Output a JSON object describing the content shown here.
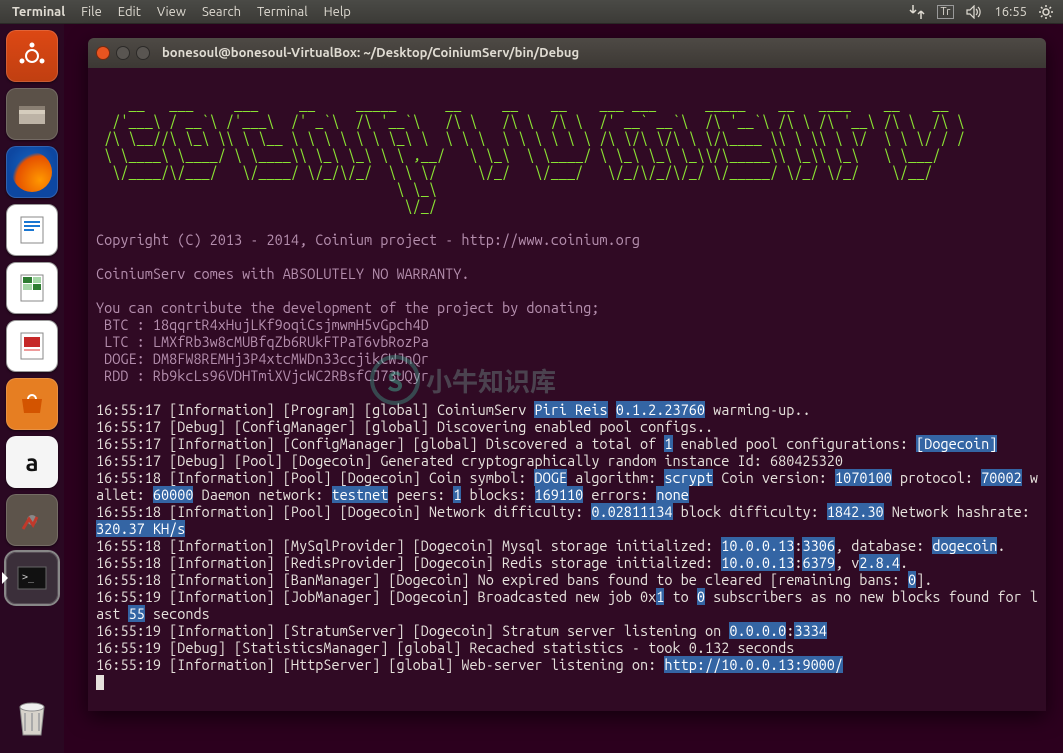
{
  "topbar": {
    "app_name": "Terminal",
    "menus": [
      "File",
      "Edit",
      "View",
      "Search",
      "Terminal",
      "Help"
    ],
    "keyboard_indicator": "Tr",
    "clock": "16:55"
  },
  "launcher": {
    "items": [
      {
        "name": "dash",
        "tip": "Dash"
      },
      {
        "name": "files",
        "tip": "Files"
      },
      {
        "name": "firefox",
        "tip": "Firefox"
      },
      {
        "name": "writer",
        "tip": "LibreOffice Writer"
      },
      {
        "name": "calc",
        "tip": "LibreOffice Calc"
      },
      {
        "name": "impress",
        "tip": "LibreOffice Impress"
      },
      {
        "name": "software",
        "tip": "Ubuntu Software"
      },
      {
        "name": "amazon",
        "tip": "Amazon"
      },
      {
        "name": "settings",
        "tip": "System Settings"
      },
      {
        "name": "terminal",
        "tip": "Terminal"
      }
    ],
    "trash": "Trash"
  },
  "window": {
    "title": "bonesoul@bonesoul-VirtualBox: ~/Desktop/CoiniumServ/bin/Debug"
  },
  "banner": {
    "ascii": "    __   ___     ___     __     _____      __     __    __    ___ ___      _____    __   ____    __    __\n  /'___\\ / __`\\ /'___\\  /' _`\\  /\\ '__`\\   /\\ \\   /\\ \\  /\\ \\  /' __` __`\\  /\\ '__`\\ /\\ \\ /\\ '__\\ /\\ \\  /\\ \\\n /\\ \\__//\\ \\_\\ \\\\ \\ \\__ \\ \\ \\ \\ \\ \\ \\_\\ \\  \\ \\ \\  \\ \\ \\ \\ \\ \\ /\\ \\/\\ \\/\\ \\ \\/\\____ \\\\ \\ \\\\ \\ \\/  \\ \\ \\/ / /\n \\ \\____\\ \\____/ \\ \\____\\\\ \\_\\ \\_\\ \\ \\ ,__/   \\ \\_\\  \\ \\____/ \\ \\_\\ \\_\\ \\_\\\\/\\_____\\\\ \\_\\\\ \\_\\   \\ \\___/\n  \\/____/\\/___/   \\/____/ \\/_/\\/_/  \\ \\ \\/     \\/_/   \\/___/   \\/_/\\/_/\\/_/ \\/_____/ \\/_/ \\/_/    \\/__/\n                                     \\ \\_\\\n                                      \\/_/",
    "copyright": "Copyright (C) 2013 - 2014, Coinium project - http://www.coinium.org",
    "warranty": "CoiniumServ comes with ABSOLUTELY NO WARRANTY.",
    "donate_header": "You can contribute the development of the project by donating;",
    "donations": [
      " BTC : 18qqrtR4xHujLKf9oqiCsjmwmH5vGpch4D",
      " LTC : LMXfRb3w8cMUBfqZb6RUkFTPaT6vbRozPa",
      " DOGE: DM8FW8REMHj3P4xtcMWDn33ccjikCWJnQr",
      " RDD : Rb9kcLs96VDHTmiXVjcWC2RBsfCJ73UQyr"
    ]
  },
  "log": {
    "lines": [
      {
        "t": "16:55:17",
        "lvl": "Information",
        "src": "Program",
        "scope": "global",
        "pre": "CoiniumServ ",
        "hl": [
          "Piri Reis",
          " ",
          "0.1.2.23760"
        ],
        "post": " warming-up.."
      },
      {
        "t": "16:55:17",
        "lvl": "Debug",
        "src": "ConfigManager",
        "scope": "global",
        "pre": "Discovering enabled pool configs..",
        "hl": [],
        "post": ""
      },
      {
        "t": "16:55:17",
        "lvl": "Information",
        "src": "ConfigManager",
        "scope": "global",
        "pre": "Discovered a total of ",
        "hl": [
          "1"
        ],
        "post": " enabled pool configurations: ",
        "tailhl": [
          "[Dogecoin]"
        ]
      },
      {
        "t": "16:55:17",
        "lvl": "Debug",
        "src": "Pool",
        "scope": "Dogecoin",
        "pre": "Generated cryptographically random instance Id: 680425320",
        "hl": [],
        "post": ""
      },
      {
        "t": "16:55:18",
        "lvl": "Information",
        "src": "Pool",
        "scope": "Dogecoin",
        "segments": [
          {
            "txt": "Coin symbol: "
          },
          {
            "hl": "DOGE"
          },
          {
            "txt": " algorithm: "
          },
          {
            "hl": "scrypt"
          },
          {
            "txt": " Coin version: "
          },
          {
            "hl": "1070100"
          },
          {
            "txt": " protocol: "
          },
          {
            "hl": "70002"
          },
          {
            "txt": " wallet: "
          },
          {
            "hl": "60000"
          },
          {
            "txt": " Daemon network: "
          },
          {
            "hl": "testnet"
          },
          {
            "txt": " peers: "
          },
          {
            "hl": "1"
          },
          {
            "txt": " blocks: "
          },
          {
            "hl": "169110"
          },
          {
            "txt": " errors: "
          },
          {
            "hl": "none"
          }
        ]
      },
      {
        "t": "16:55:18",
        "lvl": "Information",
        "src": "Pool",
        "scope": "Dogecoin",
        "segments": [
          {
            "txt": "Network difficulty: "
          },
          {
            "hl": "0.02811134"
          },
          {
            "txt": " block difficulty: "
          },
          {
            "hl": "1842.30"
          },
          {
            "txt": " Network hashrate: "
          },
          {
            "hl": "320.37 KH/s"
          }
        ]
      },
      {
        "t": "16:55:18",
        "lvl": "Information",
        "src": "MySqlProvider",
        "scope": "Dogecoin",
        "segments": [
          {
            "txt": "Mysql storage initialized: "
          },
          {
            "hl": "10.0.0.13"
          },
          {
            "txt": ":"
          },
          {
            "hl": "3306"
          },
          {
            "txt": ", database: "
          },
          {
            "hl": "dogecoin"
          },
          {
            "txt": "."
          }
        ]
      },
      {
        "t": "16:55:18",
        "lvl": "Information",
        "src": "RedisProvider",
        "scope": "Dogecoin",
        "segments": [
          {
            "txt": "Redis storage initialized: "
          },
          {
            "hl": "10.0.0.13"
          },
          {
            "txt": ":"
          },
          {
            "hl": "6379"
          },
          {
            "txt": ", v"
          },
          {
            "hl": "2.8.4"
          },
          {
            "txt": "."
          }
        ]
      },
      {
        "t": "16:55:18",
        "lvl": "Information",
        "src": "BanManager",
        "scope": "Dogecoin",
        "segments": [
          {
            "txt": "No expired bans found to be cleared [remaining bans: "
          },
          {
            "hl": "0"
          },
          {
            "txt": "]."
          }
        ]
      },
      {
        "t": "16:55:19",
        "lvl": "Information",
        "src": "JobManager",
        "scope": "Dogecoin",
        "segments": [
          {
            "txt": "Broadcasted new job 0x"
          },
          {
            "hl": "1"
          },
          {
            "txt": " to "
          },
          {
            "hl": "0"
          },
          {
            "txt": " subscribers as no new blocks found for last "
          },
          {
            "hl": "55"
          },
          {
            "txt": " seconds"
          }
        ]
      },
      {
        "t": "16:55:19",
        "lvl": "Information",
        "src": "StratumServer",
        "scope": "Dogecoin",
        "segments": [
          {
            "txt": "Stratum server listening on "
          },
          {
            "hl": "0.0.0.0"
          },
          {
            "txt": ":"
          },
          {
            "hl": "3334"
          }
        ]
      },
      {
        "t": "16:55:19",
        "lvl": "Debug",
        "src": "StatisticsManager",
        "scope": "global",
        "pre": "Recached statistics - took 0.132 seconds",
        "hl": [],
        "post": ""
      },
      {
        "t": "16:55:19",
        "lvl": "Information",
        "src": "HttpServer",
        "scope": "global",
        "segments": [
          {
            "txt": "Web-server listening on: "
          },
          {
            "hl": "http://10.0.0.13:9000/"
          }
        ]
      }
    ]
  },
  "watermark": {
    "letter": "S",
    "text": "小牛知识库"
  }
}
